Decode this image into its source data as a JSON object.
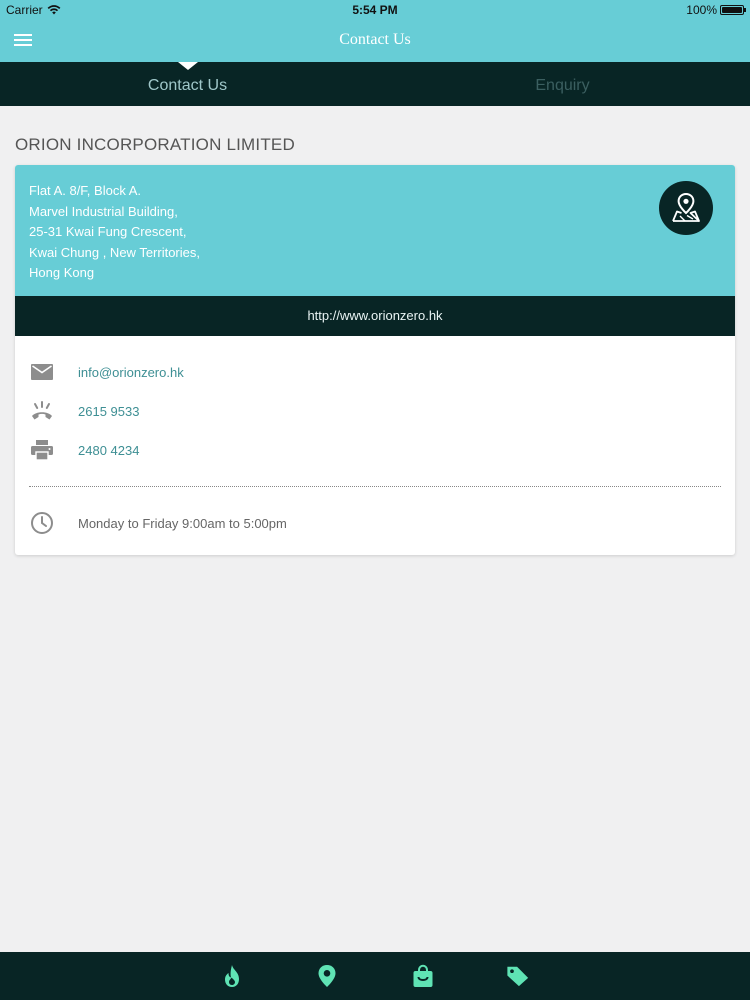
{
  "status_bar": {
    "carrier": "Carrier",
    "time": "5:54 PM",
    "battery": "100%"
  },
  "nav": {
    "title": "Contact Us",
    "menu_icon": "hamburger-menu-icon"
  },
  "tabs": [
    {
      "label": "Contact Us",
      "active": true
    },
    {
      "label": "Enquiry",
      "active": false
    }
  ],
  "company": {
    "name": "ORION INCORPORATION LIMITED",
    "address_lines": [
      "Flat A. 8/F, Block A.",
      "Marvel Industrial Building,",
      "25-31 Kwai Fung Crescent,",
      "Kwai Chung , New Territories,",
      "Hong Kong"
    ],
    "map_icon": "map-pin-icon",
    "website": "http://www.orionzero.hk",
    "email": "info@orionzero.hk",
    "phone": "2615 9533",
    "fax": "2480 4234",
    "hours": "Monday to Friday 9:00am to 5:00pm"
  },
  "bottom_tabs": [
    {
      "icon": "flame-icon"
    },
    {
      "icon": "location-pin-icon"
    },
    {
      "icon": "shopping-bag-icon"
    },
    {
      "icon": "tag-icon"
    }
  ],
  "colors": {
    "accent_teal": "#67cdd6",
    "dark_teal": "#082525",
    "link_teal": "#3e8f94",
    "bottom_icon_green": "#5fe3b4"
  }
}
